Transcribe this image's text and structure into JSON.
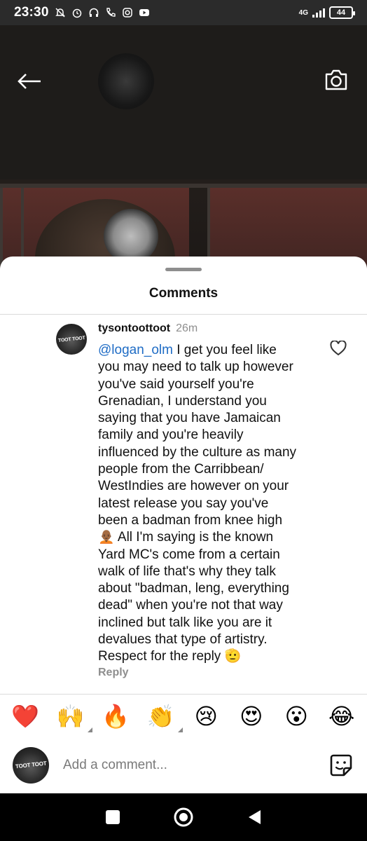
{
  "status_bar": {
    "time": "23:30",
    "network": "4G",
    "battery": "44"
  },
  "sheet": {
    "title": "Comments"
  },
  "comment": {
    "username": "tysontoottoot",
    "time": "26m",
    "mention": "@logan_olm",
    "lines": [
      " I get you feel like",
      "you may need to talk up however",
      "you've said yourself you're",
      "Grenadian, I understand you",
      "saying that you have Jamaican",
      "family and you're heavily",
      "influenced by the culture as many",
      "people from the Carribbean/",
      "WestIndies are however on your",
      "latest release you say you've",
      "been a badman from knee high",
      " All I'm saying is the known",
      "Yard MC's come from a certain",
      "walk of life that's why they talk",
      "about \"badman, leng, everything",
      "dead\" when you're not that way",
      "inclined but talk like you are it",
      "devalues that type of artistry.",
      "Respect for the reply "
    ],
    "emoji_mid": "🧑🏾‍🦲",
    "emoji_end": "🫡",
    "reply_label": "Reply",
    "avatar_logo": "TOOT TOOT"
  },
  "reactions": [
    {
      "emoji": "❤️",
      "name": "heart-emoji",
      "variants": false
    },
    {
      "emoji": "🙌",
      "name": "raised-hands-emoji",
      "variants": true
    },
    {
      "emoji": "🔥",
      "name": "fire-emoji",
      "variants": false
    },
    {
      "emoji": "👏",
      "name": "clapping-hands-emoji",
      "variants": true
    },
    {
      "emoji": "😢",
      "name": "crying-face-emoji",
      "variants": false
    },
    {
      "emoji": "😍",
      "name": "heart-eyes-emoji",
      "variants": false
    },
    {
      "emoji": "😮",
      "name": "surprised-face-emoji",
      "variants": false
    },
    {
      "emoji": "😂",
      "name": "tears-of-joy-emoji",
      "variants": false
    }
  ],
  "composer": {
    "placeholder": "Add a comment...",
    "avatar_logo": "TOOT TOOT"
  },
  "icons": {
    "back": "arrow-left-icon",
    "camera": "camera-icon",
    "like": "heart-outline-icon",
    "sticker": "sticker-icon",
    "nav_recents": "square-icon",
    "nav_home": "circle-icon",
    "nav_back": "triangle-icon"
  }
}
